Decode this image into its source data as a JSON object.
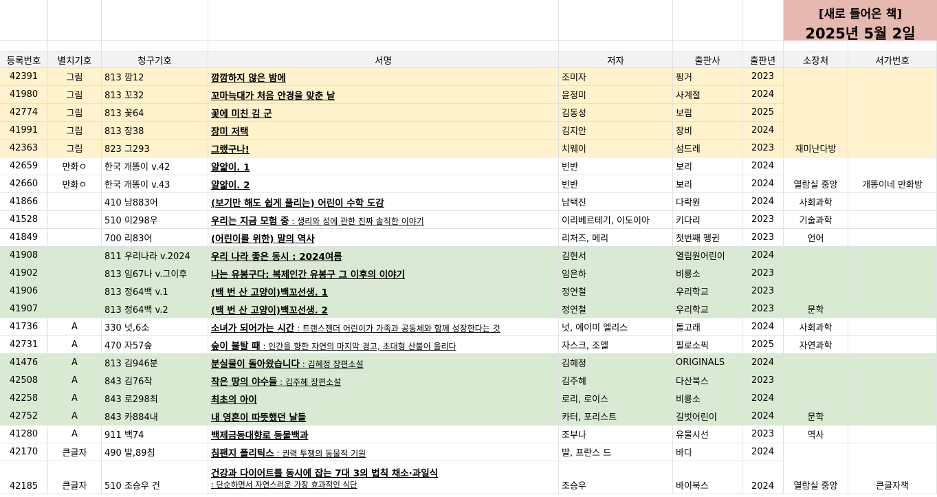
{
  "banner": {
    "line1": "[새로 들어온 책]",
    "line2": "2025년 5월 2일"
  },
  "headers": [
    "등록번호",
    "별치기호",
    "청구기호",
    "서명",
    "저자",
    "출판사",
    "출판년",
    "소장처",
    "서가번호"
  ],
  "rows": [
    {
      "reg": "42391",
      "mark": "그림",
      "call": "813 깜12",
      "title": "깜깜하지 않은 밤에",
      "sub": "",
      "author": "조미자",
      "pub": "핑거",
      "year": "2023",
      "bg": "y"
    },
    {
      "reg": "41980",
      "mark": "그림",
      "call": "813 꼬32",
      "title": "꼬마늑대가 처음 안경을 맞춘 날",
      "sub": "",
      "author": "윤정미",
      "pub": "사계절",
      "year": "2024",
      "bg": "y"
    },
    {
      "reg": "42774",
      "mark": "그림",
      "call": "813 꽃64",
      "title": "꽃에 미친 김 군",
      "sub": "",
      "author": "김동성",
      "pub": "보림",
      "year": "2025",
      "bg": "y"
    },
    {
      "reg": "41991",
      "mark": "그림",
      "call": "813 장38",
      "title": "장미 저택",
      "sub": "",
      "author": "김지안",
      "pub": "창비",
      "year": "2024",
      "bg": "y"
    },
    {
      "reg": "42363",
      "mark": "그림",
      "call": "823 그293",
      "title": "그랬구나!",
      "sub": "",
      "author": "치웨이",
      "pub": "섬드레",
      "year": "2023",
      "bg": "y"
    },
    {
      "reg": "42659",
      "mark": "만화ㅇ",
      "call": "한국 개똥이 v.42",
      "title": "얄얇이. 1",
      "sub": "",
      "author": "빈반",
      "pub": "보리",
      "year": "2024",
      "bg": "w"
    },
    {
      "reg": "42660",
      "mark": "만화ㅇ",
      "call": "한국 개똥이 v.43",
      "title": "얄얇이. 2",
      "sub": "",
      "author": "빈반",
      "pub": "보리",
      "year": "2024",
      "bg": "w"
    },
    {
      "reg": "41866",
      "mark": "",
      "call": "410 남883어",
      "title": "(보기만 해도 쉽게 풀리는) 어린이 수학 도감",
      "sub": "",
      "author": "남택진",
      "pub": "다락원",
      "year": "2024",
      "bg": "w"
    },
    {
      "reg": "41528",
      "mark": "",
      "call": "510 이298우",
      "title": "우리는 지금 모험 중",
      "sub": " : 생리와 성에 관한 진짜 솔직한 이야기",
      "author": "이리베르테기, 이도이아",
      "pub": "키다리",
      "year": "2023",
      "bg": "w"
    },
    {
      "reg": "41849",
      "mark": "",
      "call": "700 리83어",
      "title": "(어린이를 위한) 말의 역사",
      "sub": "",
      "author": "리처즈, 메리",
      "pub": "첫번째 펭귄",
      "year": "2023",
      "bg": "w"
    },
    {
      "reg": "41908",
      "mark": "",
      "call": "811 우리나라 v.2024",
      "title": "우리 나라 좋은 동시 : 2024여름",
      "sub": "",
      "author": "김현서",
      "pub": "열림원어린이",
      "year": "2024",
      "bg": "g"
    },
    {
      "reg": "41902",
      "mark": "",
      "call": "813 임67나 v.그이후",
      "title": "나는 유봉구다: 복제인간 유봉구 그 이후의 이야기",
      "sub": "",
      "author": "임은하",
      "pub": "비룡소",
      "year": "2023",
      "bg": "g"
    },
    {
      "reg": "41906",
      "mark": "",
      "call": "813 정64백 v.1",
      "title": "(백 번 산 고양이)백꼬선생. 1",
      "sub": "",
      "author": "정연철",
      "pub": "우리학교",
      "year": "2023",
      "bg": "g"
    },
    {
      "reg": "41907",
      "mark": "",
      "call": "813 정64백 v.2",
      "title": "(백 번 산 고양이)백꼬선생. 2",
      "sub": "",
      "author": "정연철",
      "pub": "우리학교",
      "year": "2023",
      "bg": "g"
    },
    {
      "reg": "41736",
      "mark": "A",
      "call": "330 넛,6소",
      "title": "소녀가 되어가는 시간",
      "sub": " : 트랜스젠더 어린이가 가족과 공동체와 함께 성장한다는 것",
      "author": "넛, 에이미 엘리스",
      "pub": "돌고래",
      "year": "2024",
      "bg": "w"
    },
    {
      "reg": "42731",
      "mark": "A",
      "call": "470 자57숲",
      "title": "숲이 불탈 때",
      "sub": " : 인간을 향한 자연의 마지막 경고, 초대형 산불이 울리다",
      "author": "자스크, 조엘",
      "pub": "필로소픽",
      "year": "2025",
      "bg": "w"
    },
    {
      "reg": "41476",
      "mark": "A",
      "call": "813 김946분",
      "title": "분실물이 돌아왔습니다",
      "sub": " : 김혜정 장편소설",
      "author": "김혜정",
      "pub": "ORIGINALS",
      "year": "2024",
      "bg": "g"
    },
    {
      "reg": "42508",
      "mark": "A",
      "call": "843 김76작",
      "title": "작은 땅의 야수들",
      "sub": " : 김주혜 장편소설",
      "author": "김주혜",
      "pub": "다산북스",
      "year": "2023",
      "bg": "g"
    },
    {
      "reg": "42258",
      "mark": "A",
      "call": "843 로298최",
      "title": "최초의 아이",
      "sub": "",
      "author": "로리, 로이스",
      "pub": "비룡소",
      "year": "2024",
      "bg": "g"
    },
    {
      "reg": "42752",
      "mark": "A",
      "call": "843 카884내",
      "title": "내 영혼이 따뜻했던 날들",
      "sub": "",
      "author": "카터, 포리스트",
      "pub": "길벗어린이",
      "year": "2024",
      "bg": "g"
    },
    {
      "reg": "41280",
      "mark": "A",
      "call": "911 백74",
      "title": "백제금동대향로 동물백과",
      "sub": "",
      "author": "조부나",
      "pub": "유물시선",
      "year": "2023",
      "bg": "w"
    },
    {
      "reg": "42170",
      "mark": "큰글자",
      "call": "490 발,89침",
      "title": "침팬지 폴리틱스",
      "sub": " : 권력 투쟁의 동물적 기원",
      "author": "발, 프란스 드",
      "pub": "바다",
      "year": "2024",
      "bg": "w"
    },
    {
      "reg": "42185",
      "mark": "큰글자",
      "call": "510 조승우 건",
      "title": "건강과 다이어트를 동시에 잡는 7대 3의 법칙 채소·과일식",
      "sub": ": 단순하면서 자연스러운 가장 효과적인 식단",
      "author": "조승우",
      "pub": "바이북스",
      "year": "2024",
      "bg": "w",
      "tall": true
    }
  ],
  "merged": [
    {
      "rows": [
        0,
        4
      ],
      "loc": "재미난다방",
      "shelf": "",
      "bg": "y"
    },
    {
      "rows": [
        5,
        6
      ],
      "loc": "열람실 중앙",
      "shelf": "개똥이네 만화방",
      "bg": "w"
    },
    {
      "rows": [
        7,
        7
      ],
      "loc": "사회과학",
      "shelf": "",
      "bg": "w"
    },
    {
      "rows": [
        8,
        8
      ],
      "loc": "기술과학",
      "shelf": "",
      "bg": "w"
    },
    {
      "rows": [
        9,
        9
      ],
      "loc": "언어",
      "shelf": "",
      "bg": "w"
    },
    {
      "rows": [
        10,
        13
      ],
      "loc": "문학",
      "shelf": "",
      "bg": "g"
    },
    {
      "rows": [
        14,
        14
      ],
      "loc": "사회과학",
      "shelf": "",
      "bg": "w"
    },
    {
      "rows": [
        15,
        15
      ],
      "loc": "자연과학",
      "shelf": "",
      "bg": "w"
    },
    {
      "rows": [
        16,
        19
      ],
      "loc": "문학",
      "shelf": "",
      "bg": "g"
    },
    {
      "rows": [
        20,
        20
      ],
      "loc": "역사",
      "shelf": "",
      "bg": "w"
    },
    {
      "rows": [
        21,
        22
      ],
      "loc": "열람실 중앙",
      "shelf": "큰글자책",
      "bg": "w"
    }
  ]
}
